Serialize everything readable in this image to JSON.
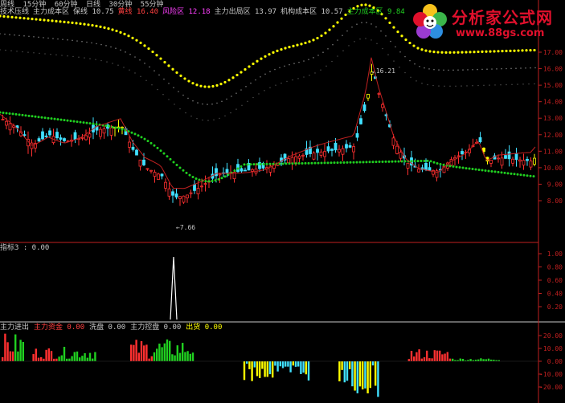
{
  "topbar": {
    "items": [
      "周线",
      "15分钟",
      "60分钟",
      "日线",
      "30分钟",
      "55分钟"
    ]
  },
  "indicators": [
    {
      "label": "技术压线",
      "value": "",
      "color": "#c8c8c8"
    },
    {
      "label": "主力成本区",
      "value": "",
      "color": "#c8c8c8"
    },
    {
      "label": "保线",
      "value": "10.75",
      "color": "#c8c8c8"
    },
    {
      "label": "黄线",
      "value": "16.40",
      "color": "#ff4040"
    },
    {
      "label": "风险区",
      "value": "12.18",
      "color": "#ff40ff"
    },
    {
      "label": "主力出局区",
      "value": "13.97",
      "color": "#c8c8c8"
    },
    {
      "label": "机构成本区",
      "value": "10.57",
      "color": "#c8c8c8"
    },
    {
      "label": "主力成本区",
      "value": "9.84",
      "color": "#20d020"
    }
  ],
  "price_axis": [
    "17.00",
    "16.00",
    "15.00",
    "14.00",
    "13.00",
    "12.00",
    "11.00",
    "10.00",
    "9.00",
    "8.00"
  ],
  "annotations": {
    "high": "16.21",
    "low": "7.66"
  },
  "osc": {
    "label": "指标3 : 0.00",
    "axis": [
      "1.00",
      "0.80",
      "0.60",
      "0.40",
      "0.20"
    ]
  },
  "volume": {
    "items": [
      {
        "label": "主力进出",
        "value": "",
        "color": "#c8c8c8"
      },
      {
        "label": "主力资金",
        "value": "0.00",
        "color": "#ff4040"
      },
      {
        "label": "洗盘",
        "value": "0.00",
        "color": "#c8c8c8"
      },
      {
        "label": "主力控盘",
        "value": "0.00",
        "color": "#c8c8c8"
      },
      {
        "label": "出货",
        "value": "0.00",
        "color": "#ffff00"
      }
    ],
    "axis": [
      "20.00",
      "10.00",
      "0.00",
      "-10.00",
      "-20.00"
    ]
  },
  "logo": {
    "title": "分析家公式网",
    "url": "www.88gs.com"
  },
  "colors": {
    "up": "#ff3030",
    "down": "#40e0ff",
    "yellow": "#ffff00",
    "green": "#20d020",
    "axis": "#c02020"
  }
}
